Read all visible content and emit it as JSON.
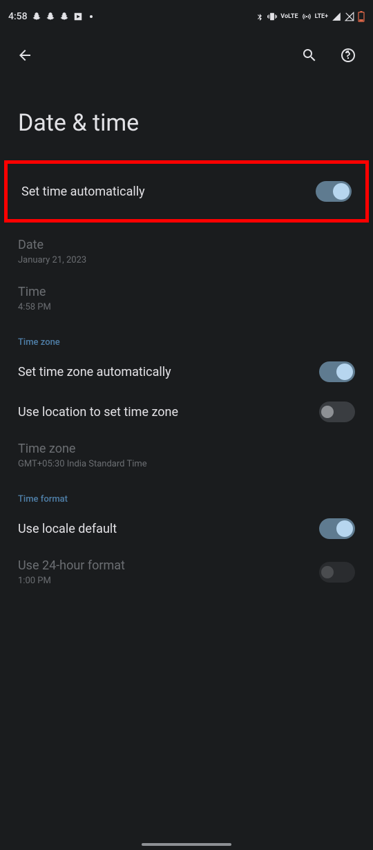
{
  "status_bar": {
    "clock": "4:58",
    "indicators_right": {
      "volte": "VoLTE",
      "lte": "LTE+"
    }
  },
  "page_title": "Date & time",
  "settings": {
    "set_time_auto": {
      "label": "Set time automatically",
      "checked": true
    },
    "date": {
      "label": "Date",
      "value": "January 21, 2023",
      "enabled": false
    },
    "time": {
      "label": "Time",
      "value": "4:58 PM",
      "enabled": false
    }
  },
  "sections": {
    "time_zone": {
      "header": "Time zone",
      "set_tz_auto": {
        "label": "Set time zone automatically",
        "checked": true
      },
      "use_location": {
        "label": "Use location to set time zone",
        "checked": false
      },
      "time_zone": {
        "label": "Time zone",
        "value": "GMT+05:30 India Standard Time",
        "enabled": false
      }
    },
    "time_format": {
      "header": "Time format",
      "use_locale_default": {
        "label": "Use locale default",
        "checked": true
      },
      "use_24h": {
        "label": "Use 24-hour format",
        "value": "1:00 PM",
        "checked": false,
        "enabled": false
      }
    }
  }
}
